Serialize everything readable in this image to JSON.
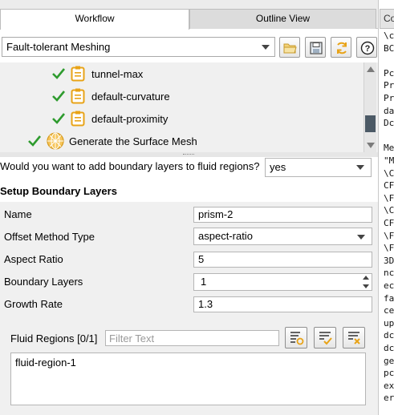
{
  "tabs": [
    {
      "label": "Workflow",
      "active": true
    },
    {
      "label": "Outline View",
      "active": false
    }
  ],
  "workflow": {
    "selected": "Fault-tolerant Meshing",
    "buttons": [
      "open-folder-icon",
      "save-icon",
      "refresh-icon",
      "help-icon"
    ]
  },
  "tree": {
    "items": [
      {
        "label": "tunnel-max",
        "status": "done",
        "icon": "task-icon"
      },
      {
        "label": "default-curvature",
        "status": "done",
        "icon": "task-icon"
      },
      {
        "label": "default-proximity",
        "status": "done",
        "icon": "task-icon"
      },
      {
        "label": "Generate the Surface Mesh",
        "status": "done",
        "icon": "globe-mesh-icon"
      }
    ]
  },
  "question": {
    "text": "Would you want to add boundary layers to fluid regions?",
    "value": "yes"
  },
  "section": {
    "title": "Setup Boundary Layers"
  },
  "form": {
    "name_label": "Name",
    "name_value": "prism-2",
    "offset_label": "Offset Method Type",
    "offset_value": "aspect-ratio",
    "aspect_label": "Aspect Ratio",
    "aspect_value": "5",
    "layers_label": "Boundary Layers",
    "layers_value": "1",
    "growth_label": "Growth Rate",
    "growth_value": "1.3",
    "fluid_label": "Fluid Regions  [0/1]",
    "filter_placeholder": "Filter Text",
    "fluid_items": [
      "fluid-region-1"
    ]
  },
  "console": {
    "tab": "Co",
    "lines": [
      "\\c",
      "BC",
      "",
      "Pc",
      "Pr",
      "Pr",
      "da",
      "Dc",
      "",
      "Me",
      "\"M",
      "\\C",
      "CF",
      "\\F",
      "\\C",
      "CF",
      "\\F",
      "\\F",
      "3D",
      "nc",
      "ec",
      "fa",
      "ce",
      "up",
      "dc",
      "dc",
      "ge",
      "pc",
      "ex",
      "er"
    ]
  },
  "colors": {
    "check": "#2e9b2e",
    "task_icon": "#e8a317",
    "scroll_thumb": "#4c5a66"
  }
}
